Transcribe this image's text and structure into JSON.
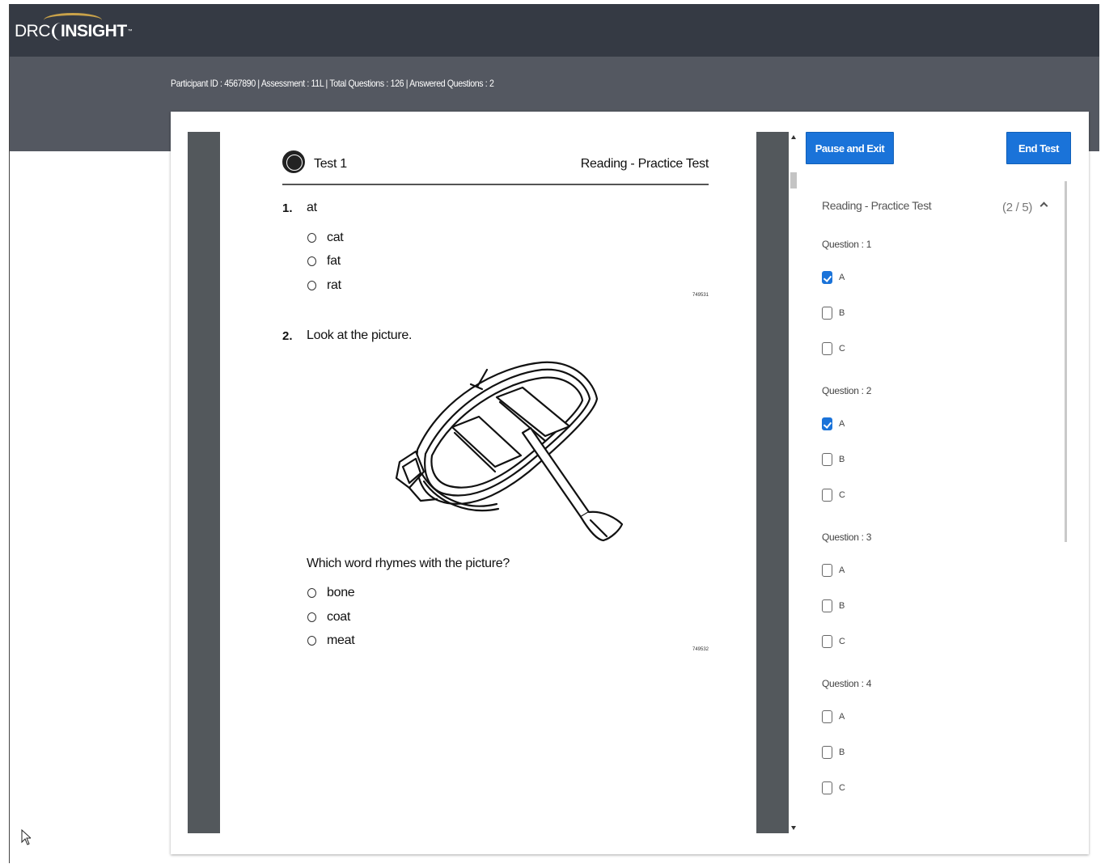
{
  "header": {
    "logo_text_drc": "DRC",
    "logo_text_insight": "INSIGHT",
    "logo_tm": "™"
  },
  "info_bar": {
    "text": "Participant ID : 4567890 | Assessment : 11L | Total Questions : 126 | Answered Questions : 2"
  },
  "document": {
    "test_label": "Test 1",
    "subject_label": "Reading - Practice Test",
    "questions": [
      {
        "number": "1.",
        "prompt": "at",
        "options": [
          "cat",
          "fat",
          "rat"
        ],
        "item_code": "749531"
      },
      {
        "number": "2.",
        "prompt": "Look at the picture.",
        "sub_prompt": "Which word rhymes with the picture?",
        "options": [
          "bone",
          "coat",
          "meat"
        ],
        "item_code": "749532",
        "image": "rowboat-with-oar"
      }
    ]
  },
  "toolbar": {
    "pause_label": "Pause and Exit",
    "end_label": "End Test"
  },
  "panel": {
    "title": "Reading - Practice Test",
    "count": "(2 / 5)",
    "collapse_icon": "chevron-up-icon",
    "questions": [
      {
        "label": "Question : 1",
        "answers": [
          {
            "letter": "A",
            "checked": true
          },
          {
            "letter": "B",
            "checked": false
          },
          {
            "letter": "C",
            "checked": false
          }
        ]
      },
      {
        "label": "Question : 2",
        "answers": [
          {
            "letter": "A",
            "checked": true
          },
          {
            "letter": "B",
            "checked": false
          },
          {
            "letter": "C",
            "checked": false
          }
        ]
      },
      {
        "label": "Question : 3",
        "answers": [
          {
            "letter": "A",
            "checked": false
          },
          {
            "letter": "B",
            "checked": false
          },
          {
            "letter": "C",
            "checked": false
          }
        ]
      },
      {
        "label": "Question : 4",
        "answers": [
          {
            "letter": "A",
            "checked": false
          },
          {
            "letter": "B",
            "checked": false
          },
          {
            "letter": "C",
            "checked": false
          }
        ]
      }
    ]
  },
  "colors": {
    "topbar": "#353a44",
    "infobar": "#545861",
    "accent": "#1a73d9",
    "viewer_gutter": "#53585c"
  }
}
